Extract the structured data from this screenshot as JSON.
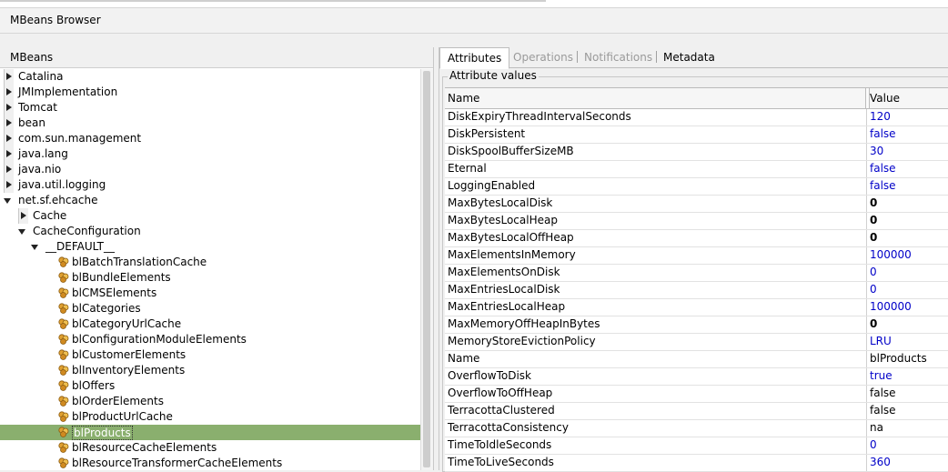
{
  "window": {
    "title": "MBeans Browser"
  },
  "left_panel": {
    "header": "MBeans",
    "tree": [
      {
        "label": "Catalina",
        "level": 0,
        "toggle": "collapsed",
        "bean": false
      },
      {
        "label": "JMImplementation",
        "level": 0,
        "toggle": "collapsed",
        "bean": false
      },
      {
        "label": "Tomcat",
        "level": 0,
        "toggle": "collapsed",
        "bean": false
      },
      {
        "label": "bean",
        "level": 0,
        "toggle": "collapsed",
        "bean": false
      },
      {
        "label": "com.sun.management",
        "level": 0,
        "toggle": "collapsed",
        "bean": false
      },
      {
        "label": "java.lang",
        "level": 0,
        "toggle": "collapsed",
        "bean": false
      },
      {
        "label": "java.nio",
        "level": 0,
        "toggle": "collapsed",
        "bean": false
      },
      {
        "label": "java.util.logging",
        "level": 0,
        "toggle": "collapsed",
        "bean": false
      },
      {
        "label": "net.sf.ehcache",
        "level": 0,
        "toggle": "expanded",
        "bean": false
      },
      {
        "label": "Cache",
        "level": 1,
        "toggle": "collapsed",
        "bean": false
      },
      {
        "label": "CacheConfiguration",
        "level": 1,
        "toggle": "expanded",
        "bean": false
      },
      {
        "label": "__DEFAULT__",
        "level": 2,
        "toggle": "expanded",
        "bean": false
      },
      {
        "label": "blBatchTranslationCache",
        "level": 3,
        "toggle": "none",
        "bean": true
      },
      {
        "label": "blBundleElements",
        "level": 3,
        "toggle": "none",
        "bean": true
      },
      {
        "label": "blCMSElements",
        "level": 3,
        "toggle": "none",
        "bean": true
      },
      {
        "label": "blCategories",
        "level": 3,
        "toggle": "none",
        "bean": true
      },
      {
        "label": "blCategoryUrlCache",
        "level": 3,
        "toggle": "none",
        "bean": true
      },
      {
        "label": "blConfigurationModuleElements",
        "level": 3,
        "toggle": "none",
        "bean": true
      },
      {
        "label": "blCustomerElements",
        "level": 3,
        "toggle": "none",
        "bean": true
      },
      {
        "label": "blInventoryElements",
        "level": 3,
        "toggle": "none",
        "bean": true
      },
      {
        "label": "blOffers",
        "level": 3,
        "toggle": "none",
        "bean": true
      },
      {
        "label": "blOrderElements",
        "level": 3,
        "toggle": "none",
        "bean": true
      },
      {
        "label": "blProductUrlCache",
        "level": 3,
        "toggle": "none",
        "bean": true
      },
      {
        "label": "blProducts",
        "level": 3,
        "toggle": "none",
        "bean": true,
        "selected": true
      },
      {
        "label": "blResourceCacheElements",
        "level": 3,
        "toggle": "none",
        "bean": true
      },
      {
        "label": "blResourceTransformerCacheElements",
        "level": 3,
        "toggle": "none",
        "bean": true
      }
    ]
  },
  "right_panel": {
    "tabs": [
      {
        "label": "Attributes",
        "state": "active"
      },
      {
        "label": "Operations",
        "state": "disabled"
      },
      {
        "label": "Notifications",
        "state": "disabled"
      },
      {
        "label": "Metadata",
        "state": "enabled"
      }
    ],
    "group_title": "Attribute values",
    "columns": {
      "name": "Name",
      "value": "Value"
    },
    "rows": [
      {
        "name": "DiskExpiryThreadIntervalSeconds",
        "value": "120",
        "style": "blue"
      },
      {
        "name": "DiskPersistent",
        "value": "false",
        "style": "blue"
      },
      {
        "name": "DiskSpoolBufferSizeMB",
        "value": "30",
        "style": "blue"
      },
      {
        "name": "Eternal",
        "value": "false",
        "style": "blue"
      },
      {
        "name": "LoggingEnabled",
        "value": "false",
        "style": "blue"
      },
      {
        "name": "MaxBytesLocalDisk",
        "value": "0",
        "style": "bold"
      },
      {
        "name": "MaxBytesLocalHeap",
        "value": "0",
        "style": "bold"
      },
      {
        "name": "MaxBytesLocalOffHeap",
        "value": "0",
        "style": "bold"
      },
      {
        "name": "MaxElementsInMemory",
        "value": "100000",
        "style": "blue"
      },
      {
        "name": "MaxElementsOnDisk",
        "value": "0",
        "style": "blue"
      },
      {
        "name": "MaxEntriesLocalDisk",
        "value": "0",
        "style": "blue"
      },
      {
        "name": "MaxEntriesLocalHeap",
        "value": "100000",
        "style": "blue"
      },
      {
        "name": "MaxMemoryOffHeapInBytes",
        "value": "0",
        "style": "bold"
      },
      {
        "name": "MemoryStoreEvictionPolicy",
        "value": "LRU",
        "style": "blue"
      },
      {
        "name": "Name",
        "value": "blProducts",
        "style": "plain"
      },
      {
        "name": "OverflowToDisk",
        "value": "true",
        "style": "blue"
      },
      {
        "name": "OverflowToOffHeap",
        "value": "false",
        "style": "plain"
      },
      {
        "name": "TerracottaClustered",
        "value": "false",
        "style": "plain"
      },
      {
        "name": "TerracottaConsistency",
        "value": "na",
        "style": "plain"
      },
      {
        "name": "TimeToIdleSeconds",
        "value": "0",
        "style": "blue"
      },
      {
        "name": "TimeToLiveSeconds",
        "value": "360",
        "style": "blue"
      }
    ]
  }
}
